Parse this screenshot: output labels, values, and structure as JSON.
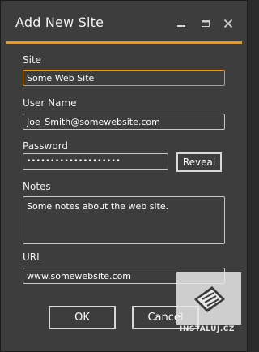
{
  "window": {
    "title": "Add New Site",
    "accent_color": "#f0960f"
  },
  "controls": {
    "minimize_icon": "minimize-icon",
    "maximize_icon": "restore-icon",
    "close_icon": "close-icon"
  },
  "form": {
    "site_label": "Site",
    "site_value": "Some Web Site",
    "username_label": "User Name",
    "username_value": "Joe_Smith@somewebsite.com",
    "password_label": "Password",
    "password_value": "••••••••••••••••••••",
    "reveal_label": "Reveal",
    "notes_label": "Notes",
    "notes_value": "Some notes about the web site.",
    "url_label": "URL",
    "url_value": "www.somewebsite.com"
  },
  "buttons": {
    "ok_label": "OK",
    "cancel_label": "Cancel"
  },
  "watermark": {
    "text": "INSTALUJ.CZ"
  }
}
